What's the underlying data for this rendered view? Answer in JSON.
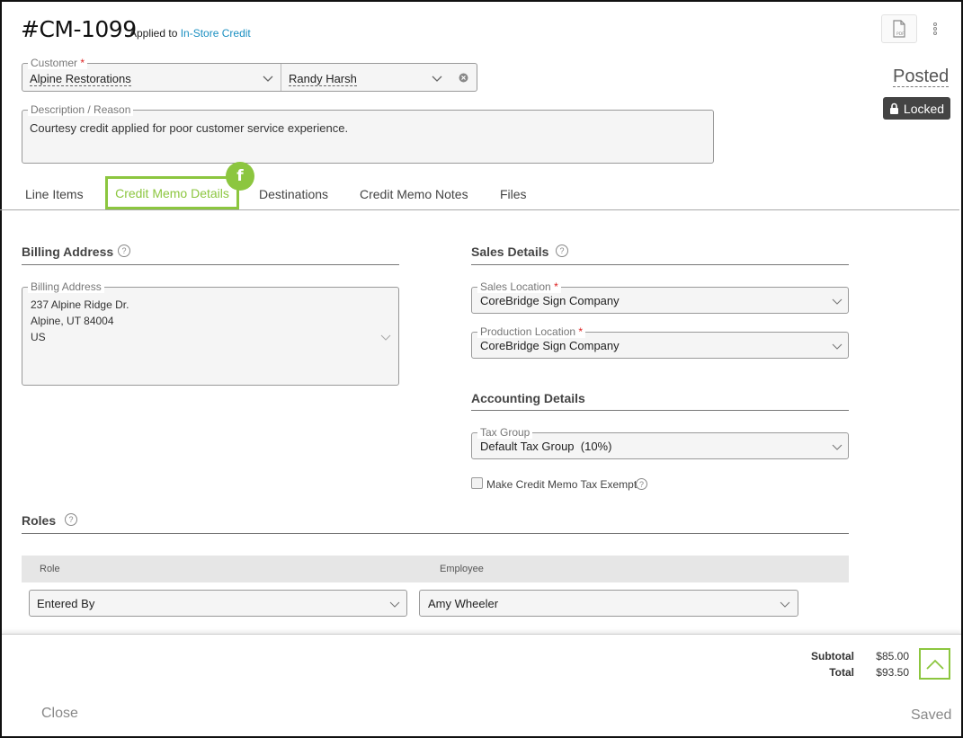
{
  "header": {
    "memo_id": "#CM-1099",
    "applied_prefix": "Applied to",
    "applied_link": "In-Store Credit",
    "status": "Posted",
    "locked_label": "Locked",
    "pdf_icon": "pdf-icon",
    "menu_icon": "kebab-menu-icon"
  },
  "customer": {
    "label": "Customer",
    "required_mark": "*",
    "company": "Alpine Restorations",
    "contact": "Randy Harsh"
  },
  "description": {
    "label": "Description / Reason",
    "value": "Courtesy credit applied for poor customer service experience."
  },
  "tabs": [
    {
      "label": "Line Items"
    },
    {
      "label": "Credit Memo Details",
      "active": true
    },
    {
      "label": "Destinations"
    },
    {
      "label": "Credit Memo Notes"
    },
    {
      "label": "Files"
    }
  ],
  "tab_badge": "f",
  "billing": {
    "section_title": "Billing Address",
    "field_label": "Billing Address",
    "lines": [
      "237 Alpine Ridge Dr.",
      "Alpine, UT 84004",
      "US"
    ]
  },
  "sales": {
    "section_title": "Sales Details",
    "sales_location_label": "Sales Location",
    "sales_location": "CoreBridge Sign Company",
    "production_location_label": "Production Location",
    "production_location": "CoreBridge Sign Company",
    "required_mark": "*"
  },
  "accounting": {
    "section_title": "Accounting Details",
    "tax_group_label": "Tax Group",
    "tax_group": "Default Tax Group  (10%)",
    "tax_exempt_label": "Make Credit Memo Tax Exempt",
    "tax_exempt_checked": false
  },
  "roles": {
    "section_title": "Roles",
    "col_role": "Role",
    "col_employee": "Employee",
    "rows": [
      {
        "role": "Entered By",
        "employee": "Amy Wheeler"
      }
    ]
  },
  "totals": {
    "subtotal_label": "Subtotal",
    "subtotal": "$85.00",
    "total_label": "Total",
    "total": "$93.50"
  },
  "footer": {
    "close_label": "Close",
    "saved_label": "Saved"
  },
  "colors": {
    "accent": "#8cc63f",
    "link": "#1a8fc1",
    "locked_bg": "#444444",
    "required": "#dd2222"
  }
}
